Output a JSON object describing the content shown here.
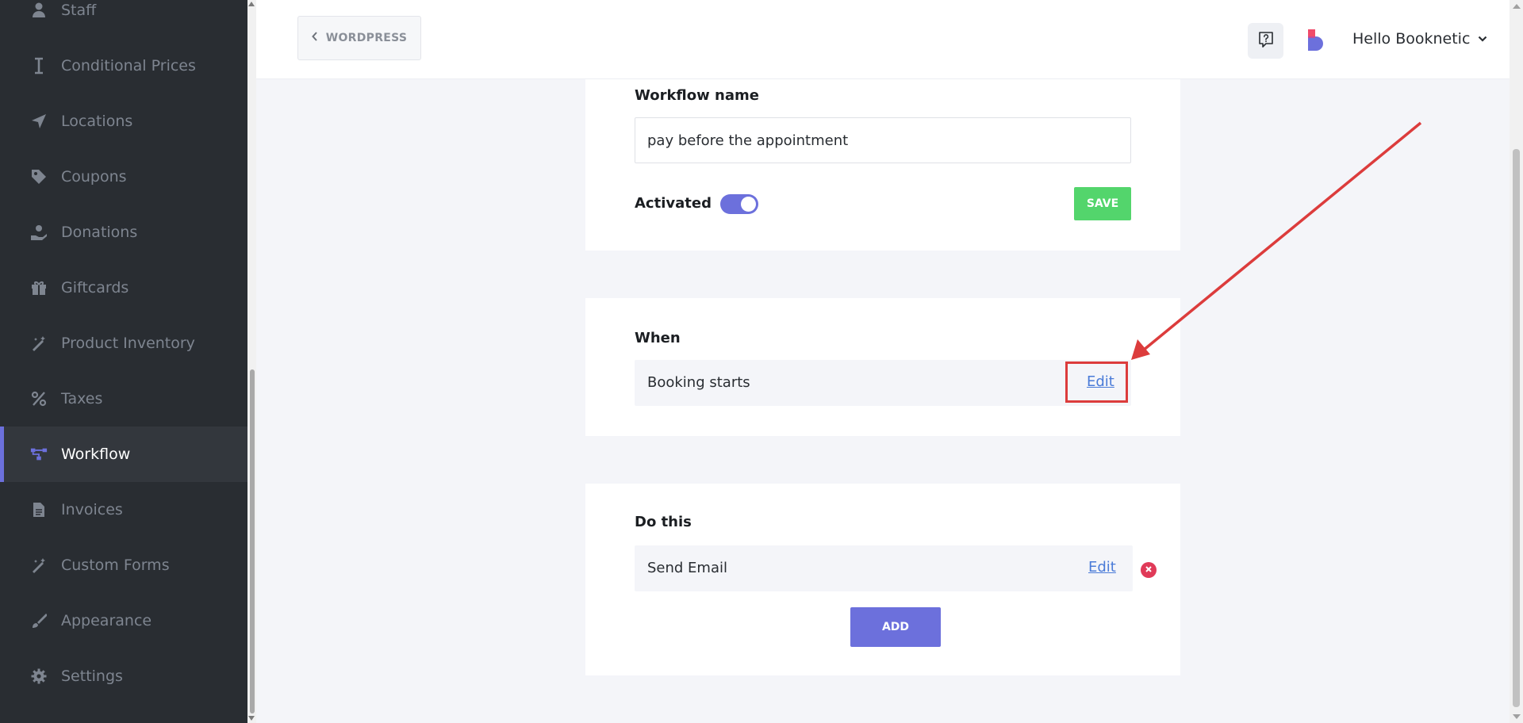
{
  "sidebar": {
    "items": [
      {
        "label": "Staff",
        "icon": "user-icon"
      },
      {
        "label": "Conditional Prices",
        "icon": "text-cursor-icon"
      },
      {
        "label": "Locations",
        "icon": "location-arrow-icon"
      },
      {
        "label": "Coupons",
        "icon": "tag-icon"
      },
      {
        "label": "Donations",
        "icon": "hand-holding-icon"
      },
      {
        "label": "Giftcards",
        "icon": "gift-icon"
      },
      {
        "label": "Product Inventory",
        "icon": "magic-wand-icon"
      },
      {
        "label": "Taxes",
        "icon": "percent-icon"
      },
      {
        "label": "Workflow",
        "icon": "workflow-icon",
        "active": true
      },
      {
        "label": "Invoices",
        "icon": "file-icon"
      },
      {
        "label": "Custom Forms",
        "icon": "magic-wand-icon"
      },
      {
        "label": "Appearance",
        "icon": "paint-brush-icon"
      },
      {
        "label": "Settings",
        "icon": "gear-icon"
      }
    ]
  },
  "header": {
    "back_label": "WORDPRESS",
    "user_greeting": "Hello Booknetic"
  },
  "workflow": {
    "name_label": "Workflow name",
    "name_value": "pay before the appointment",
    "activated_label": "Activated",
    "activated": true,
    "save_label": "SAVE"
  },
  "when": {
    "title": "When",
    "trigger": "Booking starts",
    "edit_label": "Edit"
  },
  "do_this": {
    "title": "Do this",
    "action": "Send Email",
    "edit_label": "Edit",
    "add_label": "ADD"
  },
  "colors": {
    "accent": "#6c70dc",
    "save_green": "#53d56c",
    "delete_red": "#e03a58",
    "annotation_red": "#dc3c3c",
    "sidebar_bg": "#292d32"
  }
}
